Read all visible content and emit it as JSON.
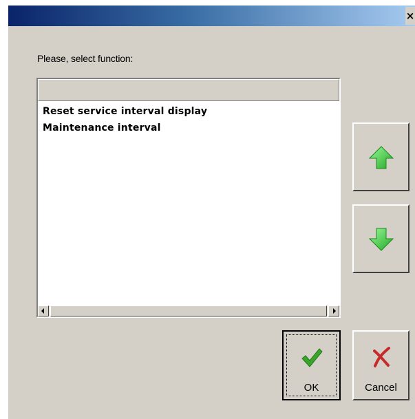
{
  "dialog": {
    "close_label": "×",
    "prompt": "Please, select function:"
  },
  "list": {
    "header": "",
    "items": [
      {
        "label": "Reset service interval display"
      },
      {
        "label": "Maintenance interval"
      }
    ]
  },
  "buttons": {
    "up_icon": "green-up-arrow-icon",
    "down_icon": "green-down-arrow-icon",
    "ok_label": "OK",
    "ok_icon": "green-checkmark-icon",
    "cancel_label": "Cancel",
    "cancel_icon": "red-x-icon"
  },
  "colors": {
    "titlebar_start": "#0a246a",
    "titlebar_end": "#a6caf0",
    "dialog_bg": "#d4d0c8",
    "arrow_green": "#3cc83c",
    "check_green": "#3aa52a",
    "cancel_red": "#c62a2a"
  }
}
